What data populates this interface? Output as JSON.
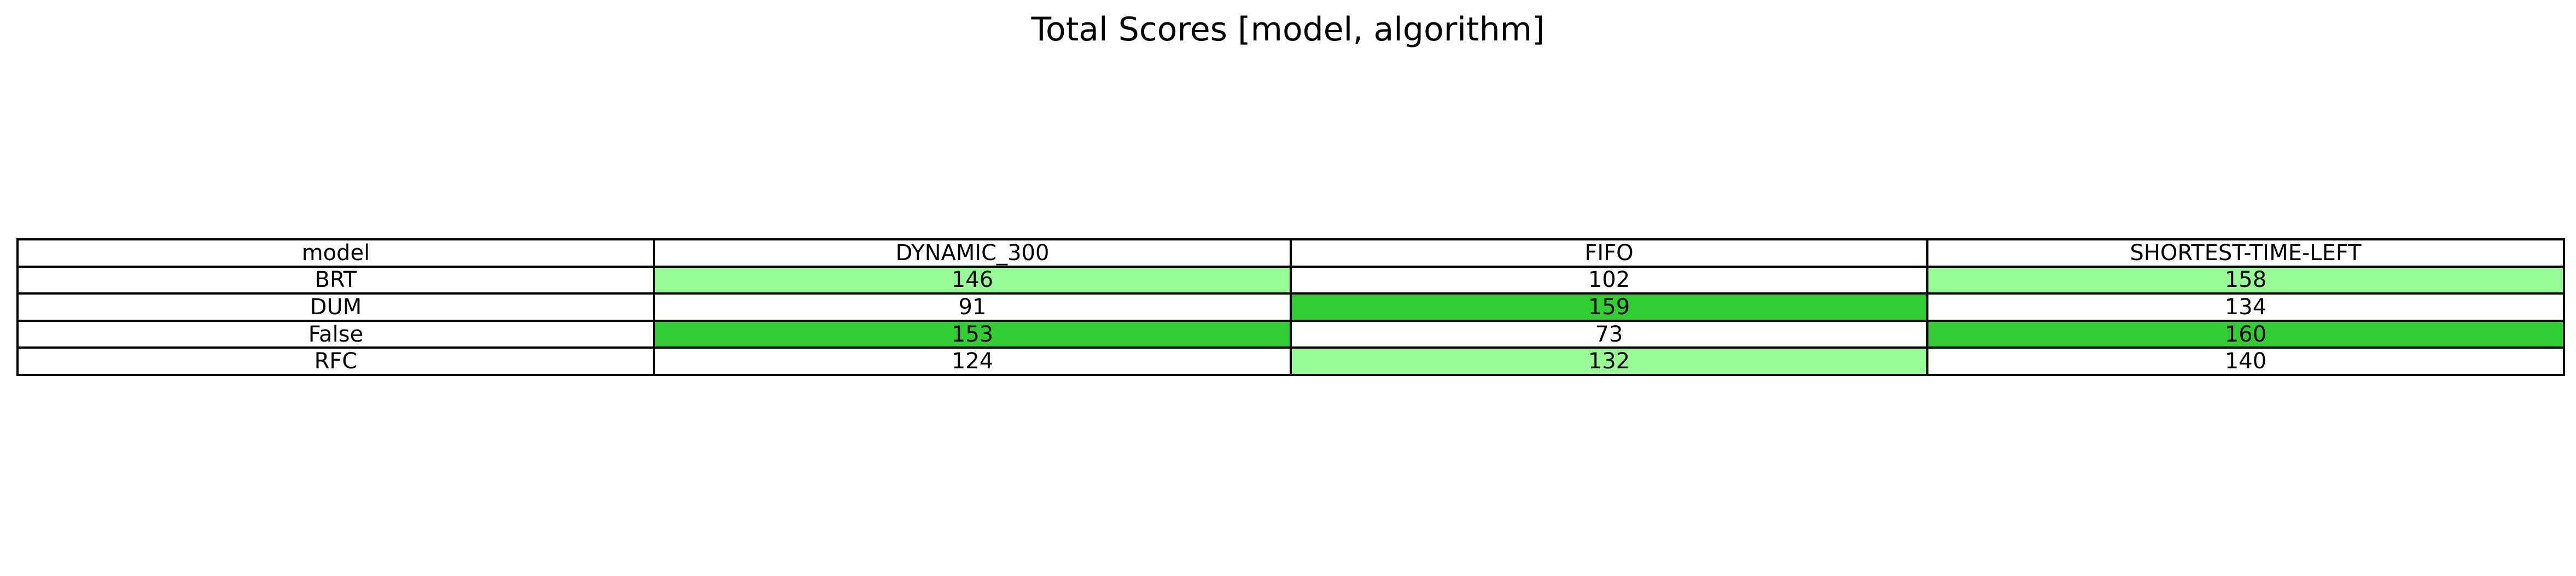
{
  "chart_data": {
    "type": "table",
    "title": "Total Scores [model, algorithm]",
    "columns": [
      "model",
      "DYNAMIC_300",
      "FIFO",
      "SHORTEST-TIME-LEFT"
    ],
    "rows": [
      {
        "model": "BRT",
        "values": [
          146,
          102,
          158
        ]
      },
      {
        "model": "DUM",
        "values": [
          91,
          159,
          134
        ]
      },
      {
        "model": "False",
        "values": [
          153,
          73,
          160
        ]
      },
      {
        "model": "RFC",
        "values": [
          124,
          132,
          140
        ]
      }
    ],
    "cell_colors": [
      [
        "#98fb98",
        "#ffffff",
        "#98fb98"
      ],
      [
        "#ffffff",
        "#32cd32",
        "#ffffff"
      ],
      [
        "#32cd32",
        "#ffffff",
        "#32cd32"
      ],
      [
        "#ffffff",
        "#98fb98",
        "#ffffff"
      ]
    ],
    "colors": {
      "top": "#32cd32",
      "second": "#98fb98",
      "default": "#ffffff",
      "border": "#000000"
    }
  }
}
